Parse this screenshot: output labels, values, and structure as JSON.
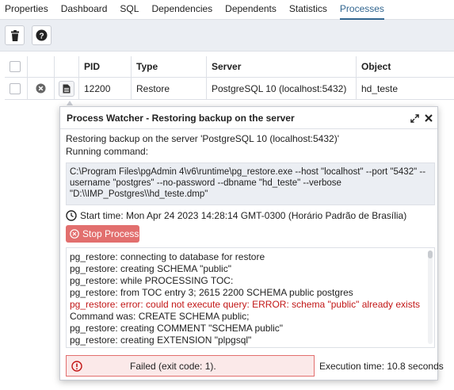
{
  "tabs": [
    {
      "label": "Properties"
    },
    {
      "label": "Dashboard"
    },
    {
      "label": "SQL"
    },
    {
      "label": "Dependencies"
    },
    {
      "label": "Dependents"
    },
    {
      "label": "Statistics"
    },
    {
      "label": "Processes"
    }
  ],
  "active_tab": "Processes",
  "toolbar": {
    "icons": [
      "trash-icon",
      "help-icon"
    ]
  },
  "table": {
    "columns": [
      "",
      "",
      "",
      "PID",
      "Type",
      "Server",
      "Object"
    ],
    "rows": [
      {
        "pid": "12200",
        "type": "Restore",
        "server": "PostgreSQL 10 (localhost:5432)",
        "object": "hd_teste"
      }
    ]
  },
  "dialog": {
    "title": "Process Watcher - Restoring backup on the server",
    "line1": "Restoring backup on the server 'PostgreSQL 10 (localhost:5432)'",
    "line2": "Running command:",
    "command": [
      "C:\\Program Files\\pgAdmin 4\\v6\\runtime\\pg_restore.exe --host \"localhost\" --port \"5432\" --",
      "username \"postgres\" --no-password --dbname \"hd_teste\" --verbose",
      "\"D:\\\\IMP_Postgres\\\\hd_teste.dmp\""
    ],
    "start_time": "Start time: Mon Apr 24 2023 14:28:14 GMT-0300 (Horário Padrão de Brasília)",
    "stop_button": "Stop Process",
    "log": [
      {
        "text": "pg_restore: connecting to database for restore",
        "error": false
      },
      {
        "text": "pg_restore: creating SCHEMA \"public\"",
        "error": false
      },
      {
        "text": "pg_restore: while PROCESSING TOC:",
        "error": false
      },
      {
        "text": "pg_restore: from TOC entry 3; 2615 2200 SCHEMA public postgres",
        "error": false
      },
      {
        "text": "pg_restore: error: could not execute query: ERROR: schema \"public\" already exists",
        "error": true
      },
      {
        "text": "Command was: CREATE SCHEMA public;",
        "error": false
      },
      {
        "text": "pg_restore: creating COMMENT \"SCHEMA public\"",
        "error": false
      },
      {
        "text": "pg_restore: creating EXTENSION \"plpgsql\"",
        "error": false
      }
    ],
    "status": "Failed (exit code: 1).",
    "execution_time": "Execution time: 10.8 seconds"
  },
  "colors": {
    "accent": "#326690",
    "error": "#c21717",
    "danger_button": "#e26f6e"
  }
}
